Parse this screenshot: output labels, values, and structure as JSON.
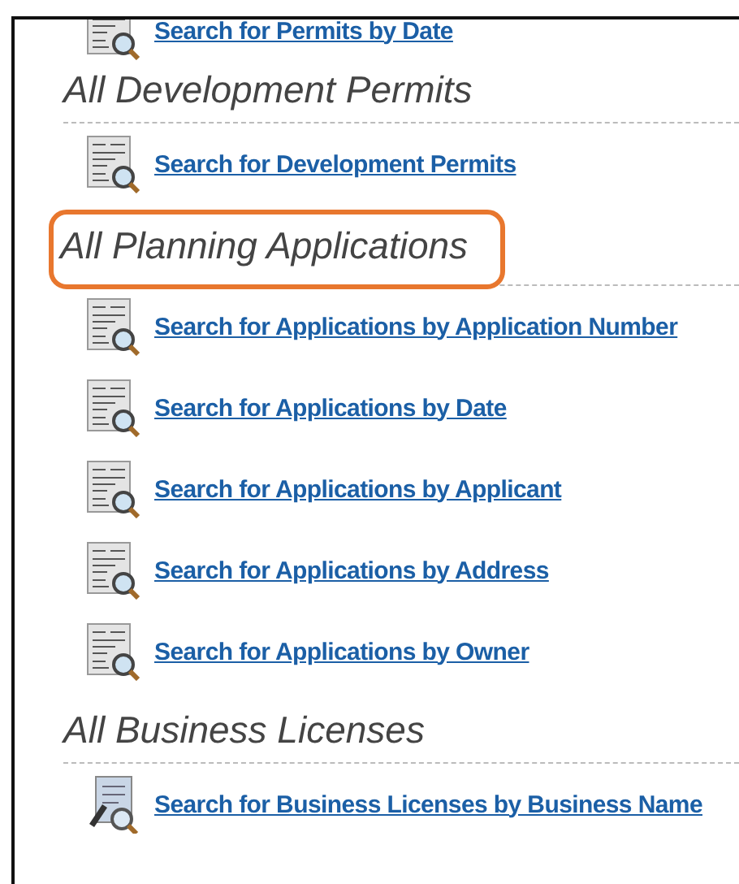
{
  "top_link": {
    "label": "Search for Permits by Date",
    "kind": "form"
  },
  "sections": [
    {
      "title": "All Development Permits",
      "highlighted": false,
      "links": [
        {
          "label": "Search for Development Permits",
          "kind": "form"
        }
      ]
    },
    {
      "title": "All Planning Applications",
      "highlighted": true,
      "links": [
        {
          "label": "Search for Applications by Application Number",
          "kind": "form"
        },
        {
          "label": "Search for Applications by Date",
          "kind": "form"
        },
        {
          "label": "Search for Applications by Applicant",
          "kind": "form"
        },
        {
          "label": "Search for Applications by Address",
          "kind": "form"
        },
        {
          "label": "Search for Applications by Owner",
          "kind": "form"
        }
      ]
    },
    {
      "title": "All Business Licenses",
      "highlighted": false,
      "links": [
        {
          "label": "Search for Business Licenses by Business Name",
          "kind": "license"
        }
      ]
    }
  ]
}
